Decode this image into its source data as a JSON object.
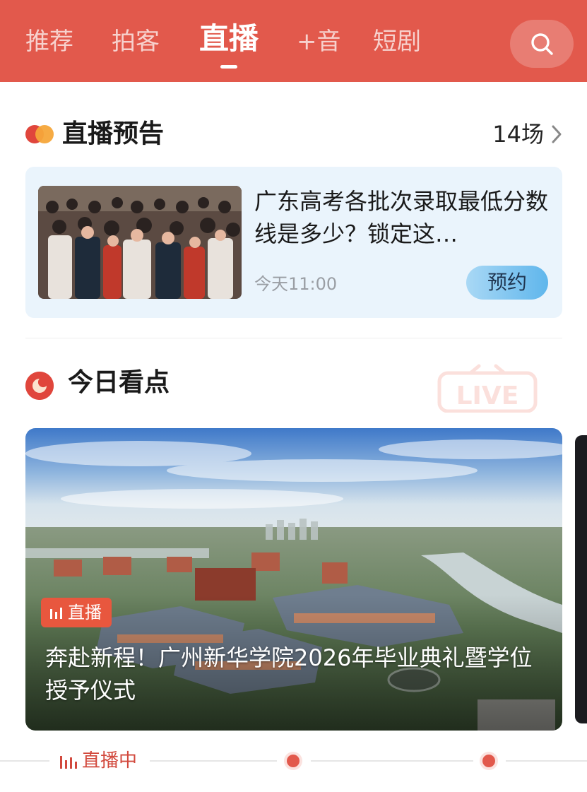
{
  "tabs": [
    {
      "label": "推荐"
    },
    {
      "label": "拍客"
    },
    {
      "label": "直播"
    },
    {
      "label": "+音"
    },
    {
      "label": "短剧"
    }
  ],
  "active_tab": "直播",
  "search": {
    "icon": "search-icon"
  },
  "preview_section": {
    "title": "直播预告",
    "count": "14场",
    "card": {
      "title": "广东高考各批次录取最低分数线是多少？锁定这…",
      "time": "今天11:00",
      "reserve_label": "预约"
    }
  },
  "today_section": {
    "title": "今日看点",
    "deco_text": "LIVE",
    "featured": {
      "badge": "直播",
      "caption": "奔赴新程！广州新华学院2026年毕业典礼暨学位授予仪式"
    }
  },
  "timeline": {
    "label": "直播中"
  },
  "colors": {
    "brand": "#e2594c",
    "reserve_button": "#5fb6ec",
    "card_background": "#eaf4fc"
  }
}
